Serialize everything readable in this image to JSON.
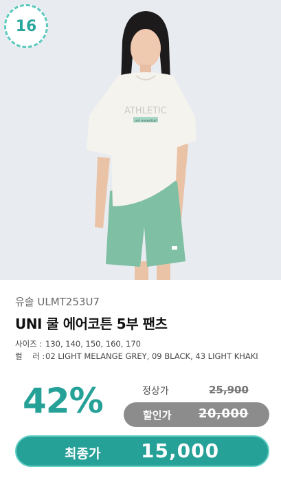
{
  "badge": {
    "number": "16"
  },
  "product": {
    "code": "유솔 ULMT253U7",
    "name": "UNI 쿨 에어코튼 5부 팬츠",
    "size_label": "사이즈 :",
    "sizes": "130, 140, 150, 160, 170",
    "color_label": "컬    러 :",
    "colors": "02 LIGHT MELANGE GREY, 09 BLACK, 43 LIGHT KHAKI",
    "tshirt_print": "ATHLETIC",
    "tshirt_tag": "uni essential"
  },
  "pricing": {
    "discount": "42%",
    "regular_label": "정상가",
    "regular_price": "25,900",
    "sale_label": "할인가",
    "sale_price": "20,000",
    "final_label": "최종가",
    "final_price": "15,000"
  },
  "colors": {
    "accent": "#26a197",
    "accent_light": "#63cfc5",
    "gray_pill": "#8c8c8c"
  }
}
